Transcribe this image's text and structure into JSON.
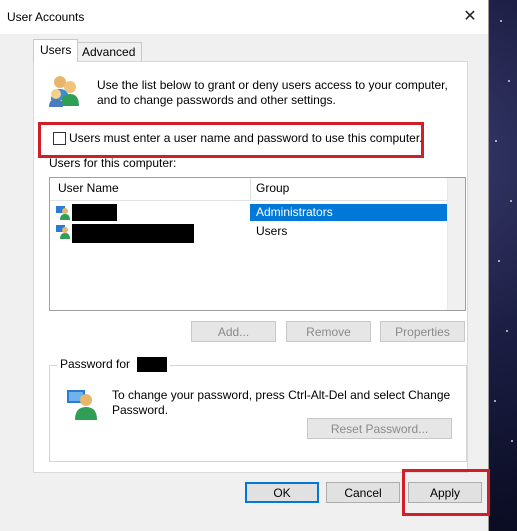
{
  "window": {
    "title": "User Accounts",
    "close_glyph": "✕"
  },
  "tabs": [
    {
      "label": "Users",
      "active": true
    },
    {
      "label": "Advanced",
      "active": false
    }
  ],
  "intro_text": "Use the list below to grant or deny users access to your computer, and to change passwords and other settings.",
  "require_login": {
    "label": "Users must enter a user name and password to use this computer.",
    "checked": false
  },
  "users_section": {
    "label": "Users for this computer:",
    "columns": [
      "User Name",
      "Group"
    ],
    "rows": [
      {
        "user": "",
        "group": "Administrators",
        "selected": true
      },
      {
        "user": "",
        "group": "Users",
        "selected": false
      }
    ]
  },
  "list_buttons": {
    "add": "Add...",
    "remove": "Remove",
    "properties": "Properties"
  },
  "password_section": {
    "title": "Password for",
    "text": "To change your password, press Ctrl-Alt-Del and select Change Password.",
    "reset_button": "Reset Password..."
  },
  "dialog_buttons": {
    "ok": "OK",
    "cancel": "Cancel",
    "apply": "Apply"
  },
  "colors": {
    "highlight": "#d11f2a",
    "selection": "#0078d7",
    "dialog_bg": "#f0f0f0"
  }
}
